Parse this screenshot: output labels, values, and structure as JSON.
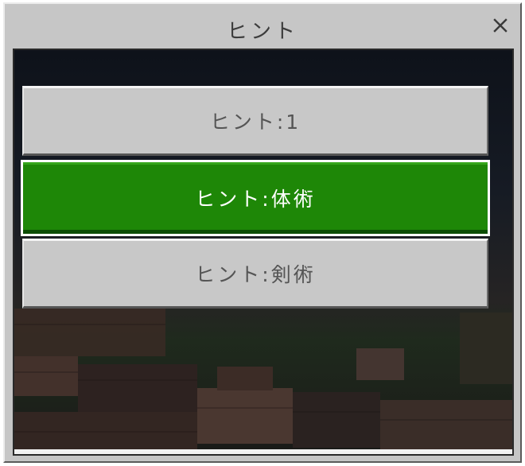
{
  "dialog": {
    "title": "ヒント",
    "close_icon": "close-icon"
  },
  "hints": [
    {
      "label": "ヒント:1",
      "selected": false
    },
    {
      "label": "ヒント:体術",
      "selected": true
    },
    {
      "label": "ヒント:剣術",
      "selected": false
    }
  ],
  "colors": {
    "panel": "#c6c6c6",
    "selected": "#1e8707",
    "button": "#c8c8c8"
  }
}
